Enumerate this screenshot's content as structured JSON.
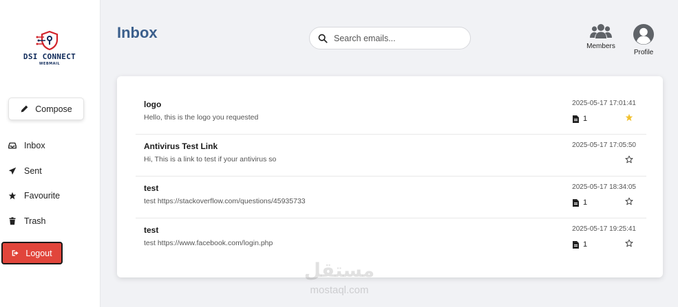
{
  "app": {
    "logo_name": "DSI CONNECT",
    "logo_sub": "WEBMAIL",
    "accent_color": "#3b5f8c",
    "logout_color": "#e1453b",
    "star_color": "#f2c12e"
  },
  "sidebar": {
    "compose_label": "Compose",
    "items": [
      {
        "label": "Inbox",
        "icon": "inbox-icon"
      },
      {
        "label": "Sent",
        "icon": "paper-plane-icon"
      },
      {
        "label": "Favourite",
        "icon": "star-icon"
      },
      {
        "label": "Trash",
        "icon": "trash-icon"
      }
    ],
    "logout_label": "Logout"
  },
  "header": {
    "title": "Inbox",
    "search_placeholder": "Search emails...",
    "members_label": "Members",
    "profile_label": "Profile"
  },
  "emails": [
    {
      "subject": "logo",
      "preview": "Hello, this is the logo you requested",
      "date": "2025-05-17 17:01:41",
      "attachments": "1",
      "starred": true
    },
    {
      "subject": "Antivirus Test Link",
      "preview": "Hi, This is a link to test if your antivirus so",
      "date": "2025-05-17 17:05:50",
      "attachments": null,
      "starred": false
    },
    {
      "subject": "test",
      "preview": "test https://stackoverflow.com/questions/45935733",
      "date": "2025-05-17 18:34:05",
      "attachments": "1",
      "starred": false
    },
    {
      "subject": "test",
      "preview": "test https://www.facebook.com/login.php",
      "date": "2025-05-17 19:25:41",
      "attachments": "1",
      "starred": false
    }
  ],
  "watermark": {
    "arabic": "مستقل",
    "latin": "mostaql.com"
  }
}
